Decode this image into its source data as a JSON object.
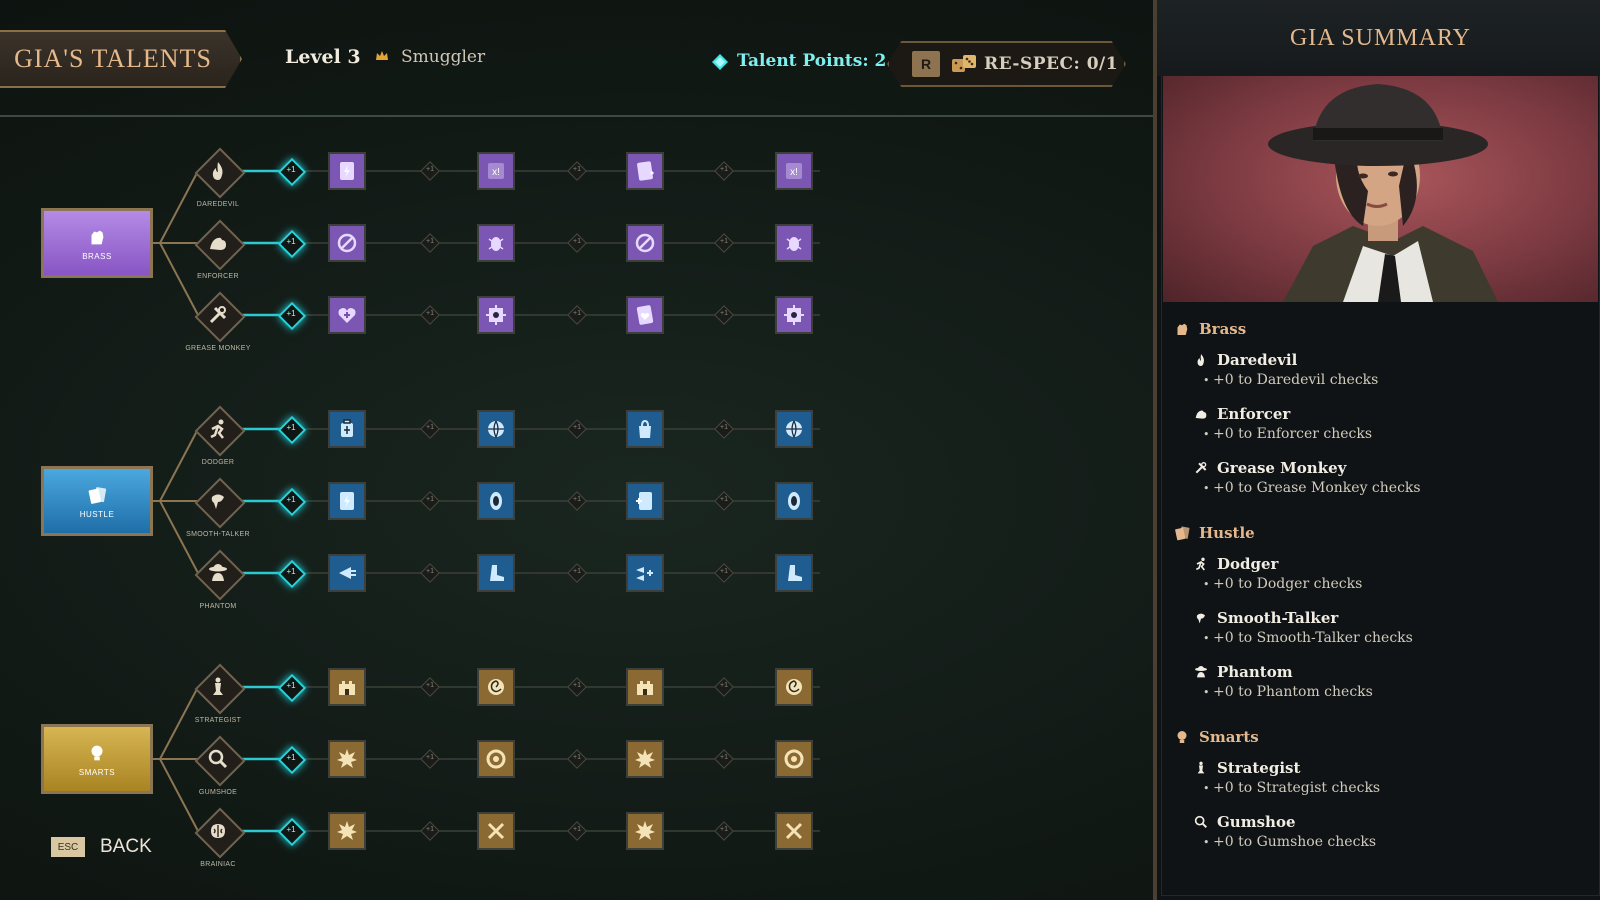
{
  "header": {
    "title": "GIA'S TALENTS",
    "level": "Level 3",
    "class_icon": "crown-icon",
    "class_name": "Smuggler",
    "talent_points": "Talent Points: 2",
    "respec_key": "R",
    "respec_label": "RE-SPEC: 0/1"
  },
  "colors": {
    "brass": "#9a6ad4",
    "hustle": "#2f86c2",
    "smarts": "#c09a3a",
    "accent_cyan": "#28d2d8",
    "gold_text": "#e4b88c"
  },
  "plus_label": "+1",
  "branches": [
    {
      "label": "BRASS",
      "icon": "fist-icon",
      "key": "brass",
      "skills": [
        {
          "label": "DAREDEVIL",
          "icon": "flame-icon",
          "tiles": [
            "card-bolt-icon",
            "x-bang-icon",
            "card-spark-icon",
            "x-bang-icon"
          ]
        },
        {
          "label": "ENFORCER",
          "icon": "muscle-icon",
          "tiles": [
            "shield-sword-icon",
            "beetle-icon",
            "shield-sword-icon",
            "beetle-icon"
          ]
        },
        {
          "label": "GREASE MONKEY",
          "icon": "tools-icon",
          "tiles": [
            "heart-plus-icon",
            "gear-grid-icon",
            "heart-card-icon",
            "gear-grid-icon"
          ]
        }
      ]
    },
    {
      "label": "HUSTLE",
      "icon": "cards-icon",
      "key": "hustle",
      "skills": [
        {
          "label": "DODGER",
          "icon": "runner-icon",
          "tiles": [
            "lantern-icon",
            "globe-icon",
            "bag-icon",
            "globe-icon"
          ]
        },
        {
          "label": "SMOOTH-TALKER",
          "icon": "speaker-icon",
          "tiles": [
            "card-bolt-icon",
            "portal-icon",
            "card-plus-icon",
            "portal-icon"
          ]
        },
        {
          "label": "PHANTOM",
          "icon": "spy-icon",
          "tiles": [
            "dash-icon",
            "boot-icon",
            "dash-plus-icon",
            "boot-icon"
          ]
        }
      ]
    },
    {
      "label": "SMARTS",
      "icon": "bulb-icon",
      "key": "smarts",
      "skills": [
        {
          "label": "STRATEGIST",
          "icon": "chess-icon",
          "tiles": [
            "fort-icon",
            "swirl-icon",
            "fort-icon",
            "swirl-icon"
          ]
        },
        {
          "label": "GUMSHOE",
          "icon": "magnifier-icon",
          "tiles": [
            "burst-icon",
            "ring-icon",
            "burst-icon",
            "ring-icon"
          ]
        },
        {
          "label": "BRAINIAC",
          "icon": "brain-icon",
          "tiles": [
            "burst-icon",
            "cross-icon",
            "burst-icon",
            "cross-icon"
          ]
        }
      ]
    }
  ],
  "back": {
    "key": "ESC",
    "label": "BACK"
  },
  "panel": {
    "title": "GIA SUMMARY",
    "portrait": "gia-portrait",
    "groups": [
      {
        "name": "Brass",
        "icon": "fist-icon",
        "entries": [
          {
            "name": "Daredevil",
            "icon": "flame-icon",
            "desc": "+0 to Daredevil checks"
          },
          {
            "name": "Enforcer",
            "icon": "muscle-icon",
            "desc": "+0 to Enforcer checks"
          },
          {
            "name": "Grease Monkey",
            "icon": "tools-icon",
            "desc": "+0 to Grease Monkey checks"
          }
        ]
      },
      {
        "name": "Hustle",
        "icon": "cards-icon",
        "entries": [
          {
            "name": "Dodger",
            "icon": "runner-icon",
            "desc": "+0 to Dodger checks"
          },
          {
            "name": "Smooth-Talker",
            "icon": "speaker-icon",
            "desc": "+0 to Smooth-Talker checks"
          },
          {
            "name": "Phantom",
            "icon": "spy-icon",
            "desc": "+0 to Phantom checks"
          }
        ]
      },
      {
        "name": "Smarts",
        "icon": "bulb-icon",
        "entries": [
          {
            "name": "Strategist",
            "icon": "chess-icon",
            "desc": "+0 to Strategist checks"
          },
          {
            "name": "Gumshoe",
            "icon": "magnifier-icon",
            "desc": "+0 to Gumshoe checks"
          }
        ]
      }
    ]
  }
}
